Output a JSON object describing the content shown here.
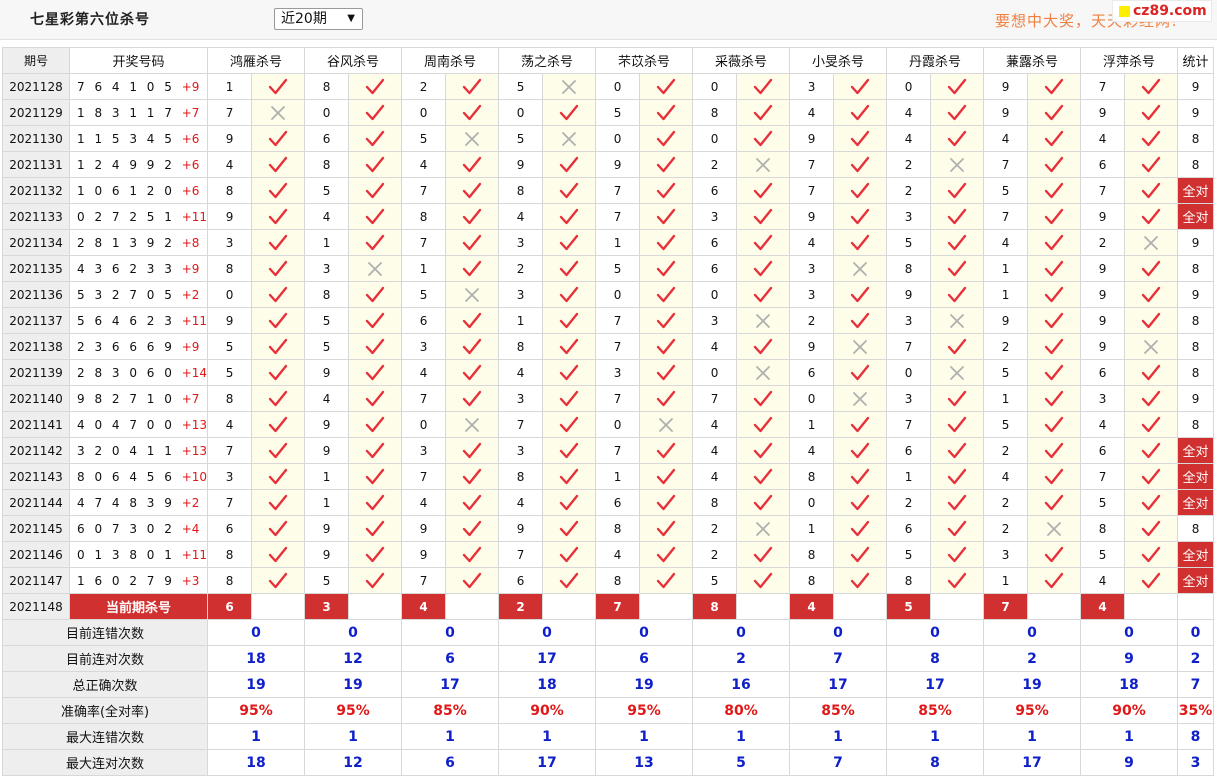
{
  "header": {
    "title": "七星彩第六位杀号",
    "range_select": "近20期",
    "slogan": "要想中大奖，天天彩经网!",
    "logo_text": "cz89.com"
  },
  "columns": {
    "issue": "期号",
    "draw": "开奖号码",
    "predictors": [
      "鸿雁杀号",
      "谷风杀号",
      "周南杀号",
      "荡之杀号",
      "芣苡杀号",
      "采薇杀号",
      "小旻杀号",
      "丹霞杀号",
      "蒹露杀号",
      "浮萍杀号"
    ],
    "stat": "统计"
  },
  "rows": [
    {
      "issue": "2021128",
      "digits": "7 6 4 1 0 5",
      "sum": "+9",
      "kills": [
        "1",
        "8",
        "2",
        "5",
        "0",
        "0",
        "3",
        "0",
        "9",
        "7"
      ],
      "hits": [
        1,
        1,
        1,
        0,
        1,
        1,
        1,
        1,
        1,
        1
      ],
      "stat": "9"
    },
    {
      "issue": "2021129",
      "digits": "1 8 3 1 1 7",
      "sum": "+7",
      "kills": [
        "7",
        "0",
        "0",
        "0",
        "5",
        "8",
        "4",
        "4",
        "9",
        "9"
      ],
      "hits": [
        0,
        1,
        1,
        1,
        1,
        1,
        1,
        1,
        1,
        1
      ],
      "stat": "9"
    },
    {
      "issue": "2021130",
      "digits": "1 1 5 3 4 5",
      "sum": "+6",
      "kills": [
        "9",
        "6",
        "5",
        "5",
        "0",
        "0",
        "9",
        "4",
        "4",
        "4"
      ],
      "hits": [
        1,
        1,
        0,
        0,
        1,
        1,
        1,
        1,
        1,
        1
      ],
      "stat": "8"
    },
    {
      "issue": "2021131",
      "digits": "1 2 4 9 9 2",
      "sum": "+6",
      "kills": [
        "4",
        "8",
        "4",
        "9",
        "9",
        "2",
        "7",
        "2",
        "7",
        "6"
      ],
      "hits": [
        1,
        1,
        1,
        1,
        1,
        0,
        1,
        0,
        1,
        1
      ],
      "stat": "8"
    },
    {
      "issue": "2021132",
      "digits": "1 0 6 1 2 0",
      "sum": "+6",
      "kills": [
        "8",
        "5",
        "7",
        "8",
        "7",
        "6",
        "7",
        "2",
        "5",
        "7"
      ],
      "hits": [
        1,
        1,
        1,
        1,
        1,
        1,
        1,
        1,
        1,
        1
      ],
      "stat": "全对"
    },
    {
      "issue": "2021133",
      "digits": "0 2 7 2 5 1",
      "sum": "+11",
      "kills": [
        "9",
        "4",
        "8",
        "4",
        "7",
        "3",
        "9",
        "3",
        "7",
        "9"
      ],
      "hits": [
        1,
        1,
        1,
        1,
        1,
        1,
        1,
        1,
        1,
        1
      ],
      "stat": "全对"
    },
    {
      "issue": "2021134",
      "digits": "2 8 1 3 9 2",
      "sum": "+8",
      "kills": [
        "3",
        "1",
        "7",
        "3",
        "1",
        "6",
        "4",
        "5",
        "4",
        "2"
      ],
      "hits": [
        1,
        1,
        1,
        1,
        1,
        1,
        1,
        1,
        1,
        0
      ],
      "stat": "9"
    },
    {
      "issue": "2021135",
      "digits": "4 3 6 2 3 3",
      "sum": "+9",
      "kills": [
        "8",
        "3",
        "1",
        "2",
        "5",
        "6",
        "3",
        "8",
        "1",
        "9"
      ],
      "hits": [
        1,
        0,
        1,
        1,
        1,
        1,
        0,
        1,
        1,
        1
      ],
      "stat": "8"
    },
    {
      "issue": "2021136",
      "digits": "5 3 2 7 0 5",
      "sum": "+2",
      "kills": [
        "0",
        "8",
        "5",
        "3",
        "0",
        "0",
        "3",
        "9",
        "1",
        "9"
      ],
      "hits": [
        1,
        1,
        0,
        1,
        1,
        1,
        1,
        1,
        1,
        1
      ],
      "stat": "9"
    },
    {
      "issue": "2021137",
      "digits": "5 6 4 6 2 3",
      "sum": "+11",
      "kills": [
        "9",
        "5",
        "6",
        "1",
        "7",
        "3",
        "2",
        "3",
        "9",
        "9"
      ],
      "hits": [
        1,
        1,
        1,
        1,
        1,
        0,
        1,
        0,
        1,
        1
      ],
      "stat": "8"
    },
    {
      "issue": "2021138",
      "digits": "2 3 6 6 6 9",
      "sum": "+9",
      "kills": [
        "5",
        "5",
        "3",
        "8",
        "7",
        "4",
        "9",
        "7",
        "2",
        "9"
      ],
      "hits": [
        1,
        1,
        1,
        1,
        1,
        1,
        0,
        1,
        1,
        0
      ],
      "stat": "8"
    },
    {
      "issue": "2021139",
      "digits": "2 8 3 0 6 0",
      "sum": "+14",
      "kills": [
        "5",
        "9",
        "4",
        "4",
        "3",
        "0",
        "6",
        "0",
        "5",
        "6"
      ],
      "hits": [
        1,
        1,
        1,
        1,
        1,
        0,
        1,
        0,
        1,
        1
      ],
      "stat": "8"
    },
    {
      "issue": "2021140",
      "digits": "9 8 2 7 1 0",
      "sum": "+7",
      "kills": [
        "8",
        "4",
        "7",
        "3",
        "7",
        "7",
        "0",
        "3",
        "1",
        "3"
      ],
      "hits": [
        1,
        1,
        1,
        1,
        1,
        1,
        0,
        1,
        1,
        1
      ],
      "stat": "9"
    },
    {
      "issue": "2021141",
      "digits": "4 0 4 7 0 0",
      "sum": "+13",
      "kills": [
        "4",
        "9",
        "0",
        "7",
        "0",
        "4",
        "1",
        "7",
        "5",
        "4"
      ],
      "hits": [
        1,
        1,
        0,
        1,
        0,
        1,
        1,
        1,
        1,
        1
      ],
      "stat": "8"
    },
    {
      "issue": "2021142",
      "digits": "3 2 0 4 1 1",
      "sum": "+13",
      "kills": [
        "7",
        "9",
        "3",
        "3",
        "7",
        "4",
        "4",
        "6",
        "2",
        "6"
      ],
      "hits": [
        1,
        1,
        1,
        1,
        1,
        1,
        1,
        1,
        1,
        1
      ],
      "stat": "全对"
    },
    {
      "issue": "2021143",
      "digits": "8 0 6 4 5 6",
      "sum": "+10",
      "kills": [
        "3",
        "1",
        "7",
        "8",
        "1",
        "4",
        "8",
        "1",
        "4",
        "7"
      ],
      "hits": [
        1,
        1,
        1,
        1,
        1,
        1,
        1,
        1,
        1,
        1
      ],
      "stat": "全对"
    },
    {
      "issue": "2021144",
      "digits": "4 7 4 8 3 9",
      "sum": "+2",
      "kills": [
        "7",
        "1",
        "4",
        "4",
        "6",
        "8",
        "0",
        "2",
        "2",
        "5"
      ],
      "hits": [
        1,
        1,
        1,
        1,
        1,
        1,
        1,
        1,
        1,
        1
      ],
      "stat": "全对"
    },
    {
      "issue": "2021145",
      "digits": "6 0 7 3 0 2",
      "sum": "+4",
      "kills": [
        "6",
        "9",
        "9",
        "9",
        "8",
        "2",
        "1",
        "6",
        "2",
        "8"
      ],
      "hits": [
        1,
        1,
        1,
        1,
        1,
        0,
        1,
        1,
        0,
        1
      ],
      "stat": "8"
    },
    {
      "issue": "2021146",
      "digits": "0 1 3 8 0 1",
      "sum": "+11",
      "kills": [
        "8",
        "9",
        "9",
        "7",
        "4",
        "2",
        "8",
        "5",
        "3",
        "5"
      ],
      "hits": [
        1,
        1,
        1,
        1,
        1,
        1,
        1,
        1,
        1,
        1
      ],
      "stat": "全对"
    },
    {
      "issue": "2021147",
      "digits": "1 6 0 2 7 9",
      "sum": "+3",
      "kills": [
        "8",
        "5",
        "7",
        "6",
        "8",
        "5",
        "8",
        "8",
        "1",
        "4"
      ],
      "hits": [
        1,
        1,
        1,
        1,
        1,
        1,
        1,
        1,
        1,
        1
      ],
      "stat": "全对"
    }
  ],
  "current": {
    "issue": "2021148",
    "label": "当前期杀号",
    "kills": [
      "6",
      "3",
      "4",
      "2",
      "7",
      "8",
      "4",
      "5",
      "7",
      "4"
    ]
  },
  "stats": [
    {
      "label": "目前连错次数",
      "values": [
        "0",
        "0",
        "0",
        "0",
        "0",
        "0",
        "0",
        "0",
        "0",
        "0"
      ],
      "total": "0"
    },
    {
      "label": "目前连对次数",
      "values": [
        "18",
        "12",
        "6",
        "17",
        "6",
        "2",
        "7",
        "8",
        "2",
        "9"
      ],
      "total": "2"
    },
    {
      "label": "总正确次数",
      "values": [
        "19",
        "19",
        "17",
        "18",
        "19",
        "16",
        "17",
        "17",
        "19",
        "18"
      ],
      "total": "7"
    },
    {
      "label": "准确率(全对率)",
      "values": [
        "95%",
        "95%",
        "85%",
        "90%",
        "95%",
        "80%",
        "85%",
        "85%",
        "95%",
        "90%"
      ],
      "total": "35%"
    },
    {
      "label": "最大连错次数",
      "values": [
        "1",
        "1",
        "1",
        "1",
        "1",
        "1",
        "1",
        "1",
        "1",
        "1"
      ],
      "total": "8"
    },
    {
      "label": "最大连对次数",
      "values": [
        "18",
        "12",
        "6",
        "17",
        "13",
        "5",
        "7",
        "8",
        "17",
        "9"
      ],
      "total": "3"
    }
  ],
  "colors": {
    "accent_red": "#d03030",
    "check_red": "#e8303a",
    "cross_gray": "#b0b0b0",
    "stat_blue": "#1020c8",
    "percent_red": "#e01818"
  }
}
